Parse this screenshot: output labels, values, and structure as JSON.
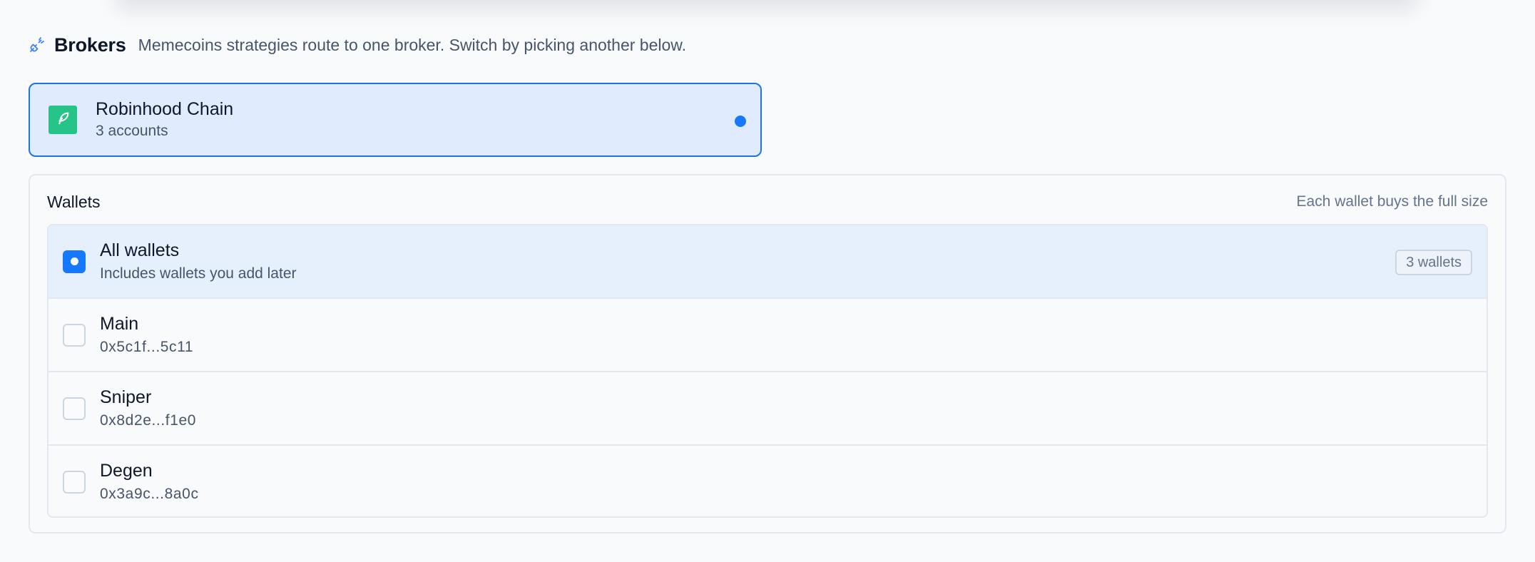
{
  "section": {
    "icon": "plug-icon",
    "title": "Brokers",
    "description": "Memecoins strategies route to one broker. Switch by picking another below."
  },
  "broker": {
    "icon": "feather-icon",
    "name": "Robinhood Chain",
    "subtitle": "3 accounts",
    "selected": true
  },
  "wallets": {
    "title": "Wallets",
    "note": "Each wallet buys the full size",
    "all": {
      "name": "All wallets",
      "subtitle": "Includes wallets you add later",
      "badge": "3 wallets",
      "checked": true
    },
    "items": [
      {
        "name": "Main",
        "address": "0x5c1f...5c11",
        "checked": false
      },
      {
        "name": "Sniper",
        "address": "0x8d2e...f1e0",
        "checked": false
      },
      {
        "name": "Degen",
        "address": "0x3a9c...8a0c",
        "checked": false
      }
    ]
  },
  "colors": {
    "accent": "#1677ff",
    "broker_brand": "#26c488",
    "selected_bg": "#e0ecfd"
  }
}
